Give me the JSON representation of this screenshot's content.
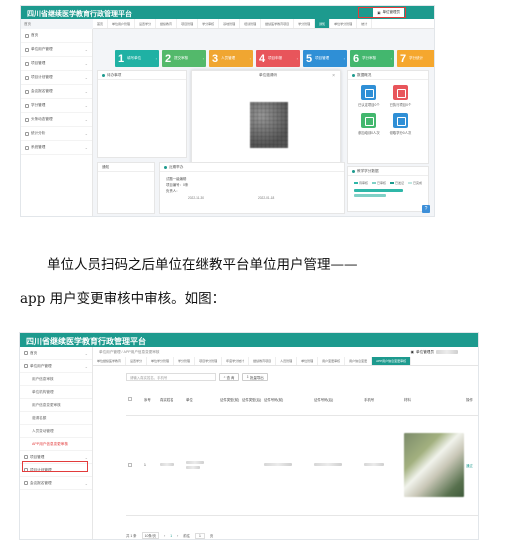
{
  "colors": {
    "brand": "#1d9a8e",
    "highlight": "#e23b3b",
    "step1": "#1fb1a4",
    "step2": "#53b96b",
    "step3": "#f0a631",
    "step4": "#e8555b",
    "step5": "#2f8fd6",
    "step6": "#43b76e",
    "step7": "#f5a72e"
  },
  "shot1": {
    "app_title": "四川省继续医学教育行政管理平台",
    "home": "首页",
    "user_label": "单位管理员",
    "tabs": [
      "首页",
      "单位用户管理",
      "设置学分",
      "继续教育",
      "项目管理",
      "学分审核",
      "基地管理",
      "培训管理",
      "继续医学教育项目",
      "学分管理",
      "通知",
      "单位学分管理",
      "统计"
    ],
    "sidebar": [
      "首页",
      "单位用户管理",
      "项目管理",
      "项目计划管理",
      "会议报名管理",
      "学分管理",
      "头条动态管理",
      "统计分析",
      "系统管理"
    ],
    "steps": [
      {
        "n": "1",
        "t": "填写单位"
      },
      {
        "n": "2",
        "t": "提交审核"
      },
      {
        "n": "3",
        "t": "人员管理"
      },
      {
        "n": "4",
        "t": "项目申报"
      },
      {
        "n": "5",
        "t": "项目管理"
      },
      {
        "n": "6",
        "t": "学分审核"
      },
      {
        "n": "7",
        "t": "学分统计"
      }
    ],
    "panel_pending": "待办事项",
    "panel_invite": "单位邀请码",
    "panel_overview": "数据概况",
    "tiles": [
      {
        "label": "已认定项目0个",
        "color": "#2f8fd6"
      },
      {
        "label": "已执行项目0个",
        "color": "#e8555b"
      },
      {
        "label": "参加培训0人次",
        "color": "#43b76e"
      },
      {
        "label": "领取学分0人次",
        "color": "#2f8fd6"
      }
    ],
    "panel_notice": "通知",
    "panel_recent": "近期举办",
    "recent_item": "试题一级编辑",
    "recent_status1": "项目编号：0条",
    "recent_status2": "负责人：",
    "recent_date1": "2022-11-30",
    "recent_date2": "2022-01-18",
    "btn_close": "关 闭",
    "btn_save": "保存图片",
    "panel_stats": "教学学分数据",
    "legend": [
      "待审核",
      "已审核",
      "已发证",
      "已完成"
    ],
    "help": "?"
  },
  "paragraph": {
    "line1": "单位人员扫码之后单位在继教平台单位用户管理——",
    "line2": "app 用户变更审核中审核。如图："
  },
  "shot2": {
    "app_title": "四川省继续医学教育行政管理平台",
    "crumb": "单位用户管理 / APP用户信息变更审核",
    "user_label": "单位管理员",
    "tabs": [
      "单位继续医学教育",
      "设置学分",
      "单位学分管理",
      "学分管理",
      "项目学分管理",
      "年度学分统计",
      "继续教育项目",
      "人员管理",
      "单位管理",
      "用户变更审核",
      "用户信息变更",
      "APP用户信息变更审核"
    ],
    "sidebar": [
      {
        "label": "首页",
        "type": "item"
      },
      {
        "label": "单位用户管理",
        "type": "item"
      },
      {
        "label": "用户信息审核",
        "type": "sub"
      },
      {
        "label": "单位机构管理",
        "type": "sub"
      },
      {
        "label": "用户信息变更审核",
        "type": "sub"
      },
      {
        "label": "邀请名额",
        "type": "sub"
      },
      {
        "label": "人员变动管理",
        "type": "sub"
      },
      {
        "label": "APP用户信息变更审核",
        "type": "sub",
        "active": true
      },
      {
        "label": "项目管理",
        "type": "item"
      },
      {
        "label": "项目计划管理",
        "type": "item"
      },
      {
        "label": "会议报名管理",
        "type": "item"
      }
    ],
    "search_placeholder": "请输入真实姓名、手机号",
    "btn_search": "查 询",
    "btn_export": "批量导出",
    "columns": [
      "",
      "序号",
      "真实姓名",
      "单位",
      "证件类型(前)",
      "证件类型(后)",
      "证件号码(前)",
      "证件号码(后)",
      "手机号",
      "材料",
      "操作"
    ],
    "row": {
      "index": "1",
      "action": "通过"
    },
    "pager": {
      "total": "共 1 条",
      "per": "10条/页",
      "prev": "‹",
      "page": "1",
      "next": "›",
      "goto": "前往",
      "goto_page": "1",
      "suffix": "页"
    }
  }
}
